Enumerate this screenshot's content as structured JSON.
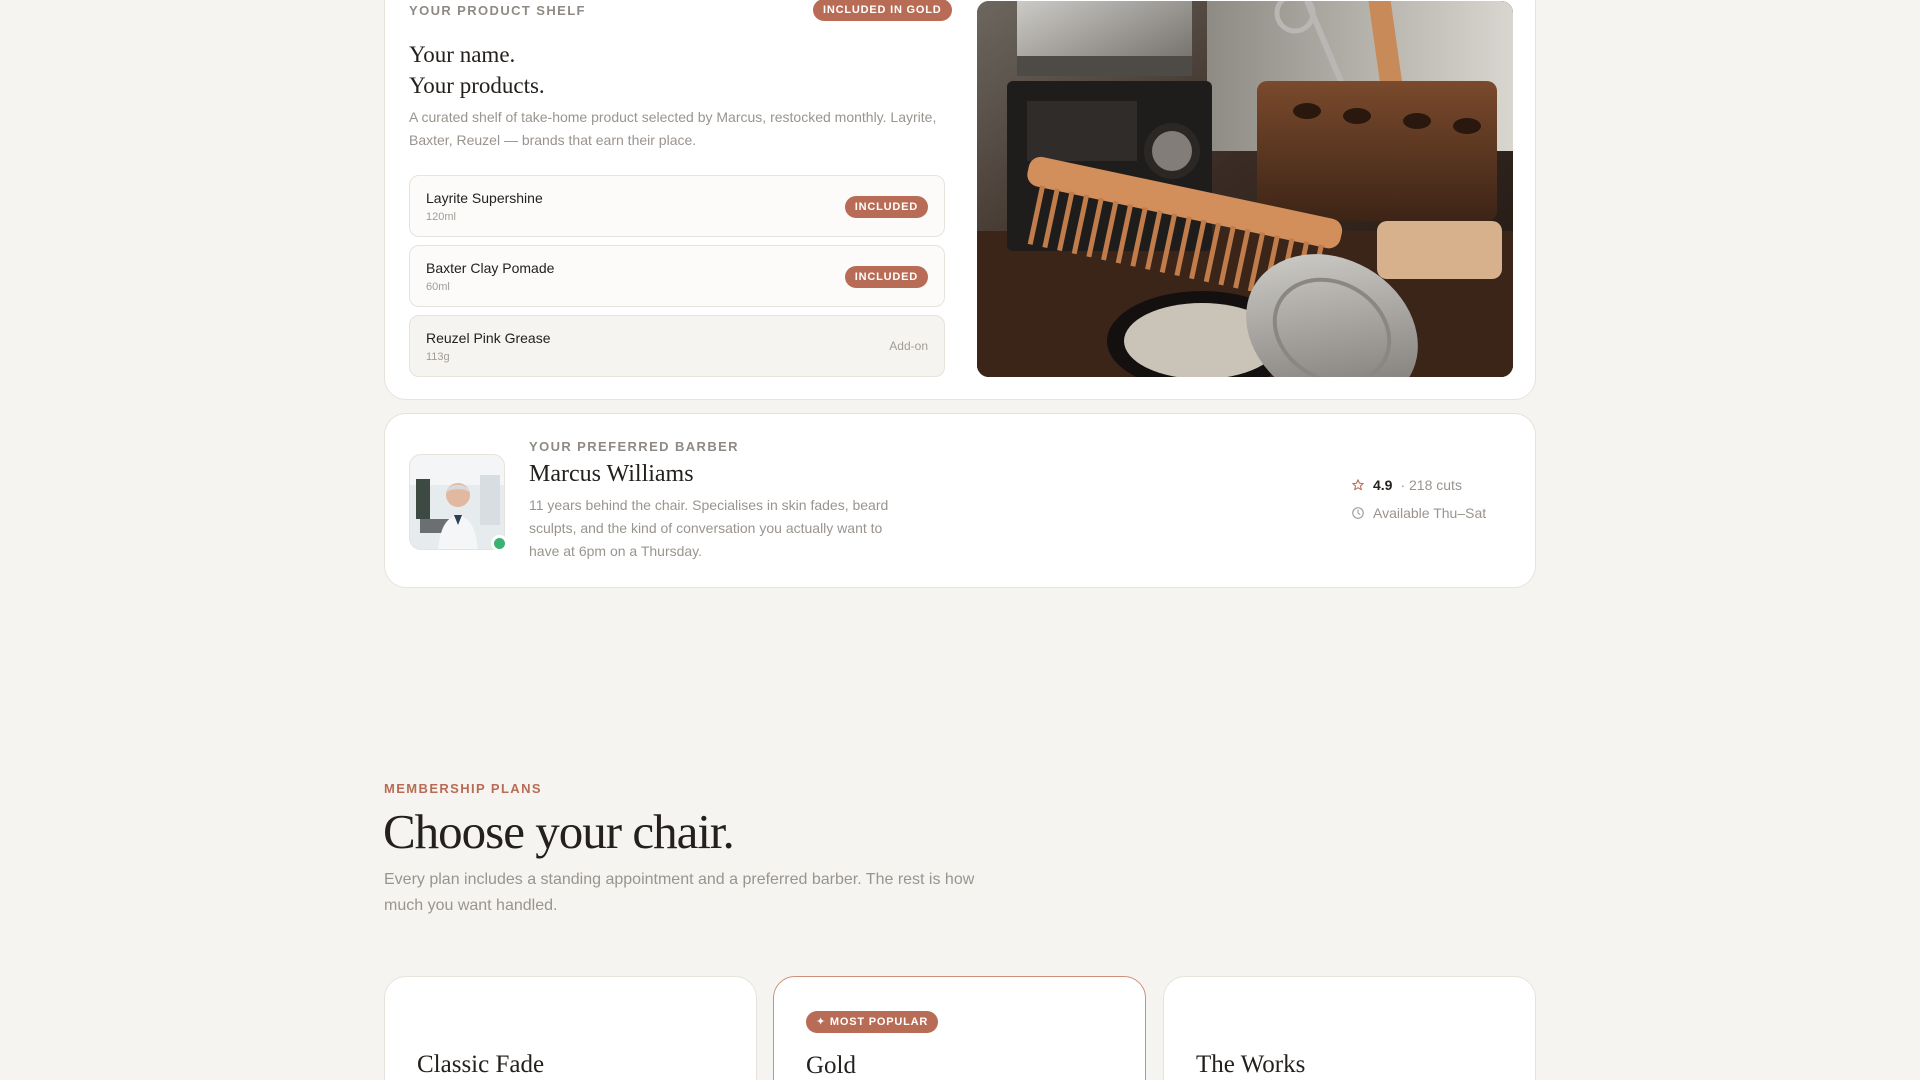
{
  "shelf": {
    "eyebrow": "YOUR PRODUCT SHELF",
    "badge": "INCLUDED IN GOLD",
    "title_line1": "Your name.",
    "title_line2": "Your products.",
    "description": "A curated shelf of take-home product selected by Marcus, restocked monthly. Layrite, Baxter, Reuzel — brands that earn their place.",
    "products": [
      {
        "name": "Layrite Supershine",
        "size": "120ml",
        "status": "INCLUDED"
      },
      {
        "name": "Baxter Clay Pomade",
        "size": "60ml",
        "status": "INCLUDED"
      },
      {
        "name": "Reuzel Pink Grease",
        "size": "113g",
        "status": "Add-on"
      }
    ]
  },
  "barber": {
    "eyebrow": "YOUR PREFERRED BARBER",
    "name": "Marcus Williams",
    "bio": "11 years behind the chair. Specialises in skin fades, beard sculpts, and the kind of conversation you actually want to have at 6pm on a Thursday.",
    "rating": "4.9",
    "cuts": "· 218 cuts",
    "availability": "Available Thu–Sat",
    "online": true
  },
  "membership": {
    "eyebrow": "MEMBERSHIP PLANS",
    "title": "Choose your chair.",
    "description": "Every plan includes a standing appointment and a preferred barber. The rest is how much you want handled.",
    "plans": [
      {
        "name": "Classic Fade",
        "badge": ""
      },
      {
        "name": "Gold",
        "badge": "✦ MOST POPULAR"
      },
      {
        "name": "The Works",
        "badge": ""
      }
    ]
  },
  "colors": {
    "accent": "#b86c55",
    "background": "#f6f4f1",
    "online": "#3bb273"
  },
  "icons": {
    "rating": "star-icon",
    "availability": "clock-icon"
  }
}
